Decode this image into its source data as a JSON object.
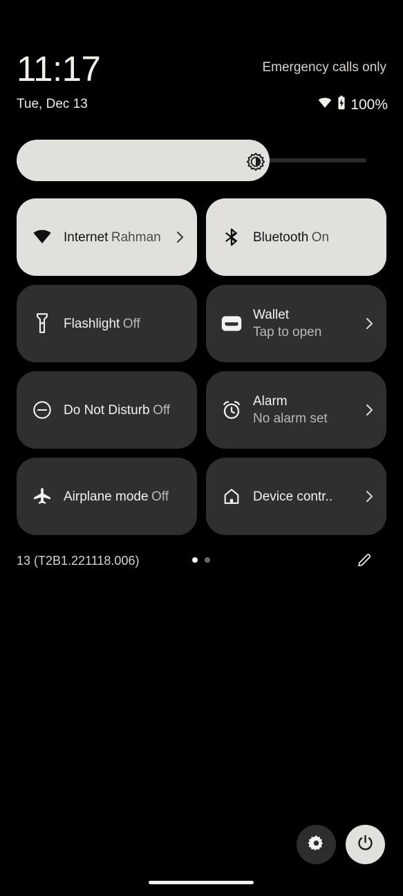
{
  "status": {
    "time": "11:17",
    "carrier": "Emergency calls only",
    "date": "Tue, Dec 13",
    "battery_percent": "100%",
    "wifi_icon": "wifi-icon",
    "battery_icon": "battery-charging-icon"
  },
  "brightness": {
    "icon": "brightness-icon",
    "fill_percent": 68
  },
  "tiles": [
    {
      "id": "internet",
      "icon": "wifi-icon",
      "title": "Internet",
      "subtitle": "Rahman",
      "state": "active",
      "chevron": true
    },
    {
      "id": "bluetooth",
      "icon": "bluetooth-icon",
      "title": "Bluetooth",
      "subtitle": "On",
      "state": "active",
      "chevron": false
    },
    {
      "id": "flashlight",
      "icon": "flashlight-icon",
      "title": "Flashlight",
      "subtitle": "Off",
      "state": "inactive",
      "chevron": false
    },
    {
      "id": "wallet",
      "icon": "wallet-icon",
      "title": "Wallet",
      "subtitle": "Tap to open",
      "state": "inactive",
      "chevron": true
    },
    {
      "id": "do-not-disturb",
      "icon": "do-not-disturb-icon",
      "title": "Do Not Disturb",
      "subtitle": "Off",
      "state": "inactive",
      "chevron": false
    },
    {
      "id": "alarm",
      "icon": "alarm-icon",
      "title": "Alarm",
      "subtitle": "No alarm set",
      "state": "inactive",
      "chevron": true
    },
    {
      "id": "airplane-mode",
      "icon": "airplane-icon",
      "title": "Airplane mode",
      "subtitle": "Off",
      "state": "inactive",
      "chevron": false
    },
    {
      "id": "device-controls",
      "icon": "home-icon",
      "title": "Device contr..",
      "subtitle": "",
      "state": "inactive",
      "chevron": true
    }
  ],
  "footer": {
    "build": "13 (T2B1.221118.006)",
    "edit_icon": "pencil-icon",
    "pages": {
      "count": 2,
      "current": 1
    }
  },
  "bottom_actions": {
    "settings_icon": "gear-icon",
    "power_icon": "power-icon"
  },
  "colors": {
    "background": "#000000",
    "tile_active": "#e1e0dd",
    "tile_inactive": "#2f2f2f",
    "text_primary": "#f3efe9",
    "text_secondary": "#b8b8b8",
    "slider_track": "#2b2b2b"
  }
}
